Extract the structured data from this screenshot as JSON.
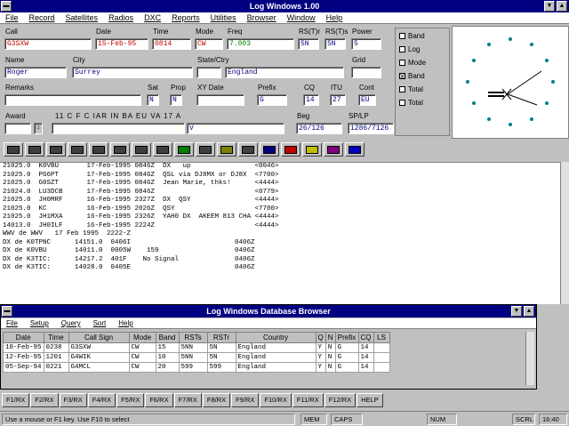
{
  "window": {
    "title": "Log Windows 1.00"
  },
  "menu": [
    "File",
    "Record",
    "Satellites",
    "Radios",
    "DXC",
    "Reports",
    "Utilities",
    "Browser",
    "Window",
    "Help"
  ],
  "form": {
    "labels": {
      "call": "Call",
      "date": "Date",
      "time": "Time",
      "mode": "Mode",
      "freq": "Freq",
      "rstr": "RS(T)r",
      "rsts": "RS(T)s",
      "power": "Power",
      "name": "Name",
      "city": "City",
      "state": "State/Ctry",
      "country": "Country",
      "grid": "Grid",
      "remarks": "Remarks",
      "sat": "Sat",
      "prop": "Prop",
      "xfdate": "XY Date",
      "prefix": "Prefix",
      "cq": "CQ",
      "itu": "ITU",
      "cont": "Cont",
      "award": "Award",
      "beg": "Beg",
      "sp_lp": "SP/LP"
    },
    "values": {
      "call": "G3SXW",
      "date": "15-Feb-95",
      "time": "0814",
      "mode": "CW",
      "freq": "7.003",
      "rstr": "5N",
      "rsts": "5N",
      "power": "5",
      "name": "Roger",
      "city": "Surrey",
      "state": "",
      "country": "England",
      "grid": "",
      "remarks": "",
      "sat": "N",
      "prop": "N",
      "xfdate": "",
      "prefix": "G",
      "cq": "14",
      "itu": "27",
      "cont": "EU",
      "award": "",
      "award2": "",
      "award3": "V",
      "beg": "26/126",
      "sp_lp": "1286/7126"
    },
    "award_cols": "11 C F C IAR IN BA EU VA 17 A"
  },
  "bands": [
    {
      "label": "Band",
      "checked": false
    },
    {
      "label": "Log",
      "checked": false
    },
    {
      "label": "Mode",
      "checked": false
    },
    {
      "label": "Band",
      "checked": true
    },
    {
      "label": "Total",
      "checked": false
    },
    {
      "label": "Total",
      "checked": false
    }
  ],
  "log_lines": [
    "21025.0  K0VBU       17-Feb-1995 0846Z  DX   up                <0046>",
    "21025.0  PG6PT       17-Feb-1995 0846Z  QSL via DJ8MX or DJ8X  <7700>",
    "21025.0  G0SZT       17-Feb-1995 0846Z  Jean Marie, thks!      <4444>",
    "21024.0  LU3DCB      17-Feb-1995 0846Z                         <0779>",
    "21025.0  JH0MRF      16-Feb-1995 2327Z  DX  QSY                <4444>",
    "21025.0  KC          16-Feb-1995 2026Z  QSY                    <7700>",
    "21025.0  JH1MXA      16-Feb-1995 2326Z  YAH0 DX  AKEEM 813 CHA <4444>",
    "14013.0  JH0ILF      16-Feb-1995 2224Z                         <4444>",
    "WWV de WWV   17 Feb 1995  2222-Z",
    "DX de K0TPNC      14151.0  0406I                          0406Z",
    "DX de K0VBU       14011.0  0005W    159                   0406Z",
    "DX de K3TIC:      14217.2  401F    No Signal              0406Z",
    "DX de K3TIC:      14028.0  0405E                          0406Z"
  ],
  "db_window": {
    "title": "Log Windows Database Browser",
    "menu": [
      "File",
      "Setup",
      "Query",
      "Sort",
      "Help"
    ],
    "columns": [
      "Date",
      "Time",
      "Call Sign",
      "Mode",
      "Band",
      "RSTs",
      "RSTr",
      "Country",
      "Q",
      "N",
      "Prefix",
      "CQ",
      "LS"
    ],
    "rows": [
      [
        "10-Feb-95",
        "0238",
        "G3SXW",
        "CW",
        "15",
        "5NN",
        "5N",
        "England",
        "Y",
        "N",
        "G",
        "14",
        ""
      ],
      [
        "12-Feb-95",
        "1201",
        "G4WIK",
        "CW",
        "10",
        "5NN",
        "5N",
        "England",
        "Y",
        "N",
        "G",
        "14",
        ""
      ],
      [
        "05-Sep-94",
        "0221",
        "G4MCL",
        "CW",
        "20",
        "599",
        "599",
        "England",
        "Y",
        "N",
        "G",
        "14",
        ""
      ]
    ]
  },
  "fkeys": [
    "F1/RX",
    "F2/RX",
    "F3/RX",
    "F4/RX",
    "F5/RX",
    "F6/RX",
    "F7/RX",
    "F8/RX",
    "F9/RX",
    "F10/RX",
    "F11/RX",
    "F12/RX",
    "HELP"
  ],
  "status": {
    "hint": "Use a mouse or F1 key. Use F10 to select",
    "mem": "MEM",
    "caps": "CAPS",
    "num": "NUM",
    "scroll": "SCRL",
    "time": "16:40"
  },
  "colors": {
    "title": "#000080",
    "field_text": "#000080",
    "accent_red": "#c00000"
  }
}
